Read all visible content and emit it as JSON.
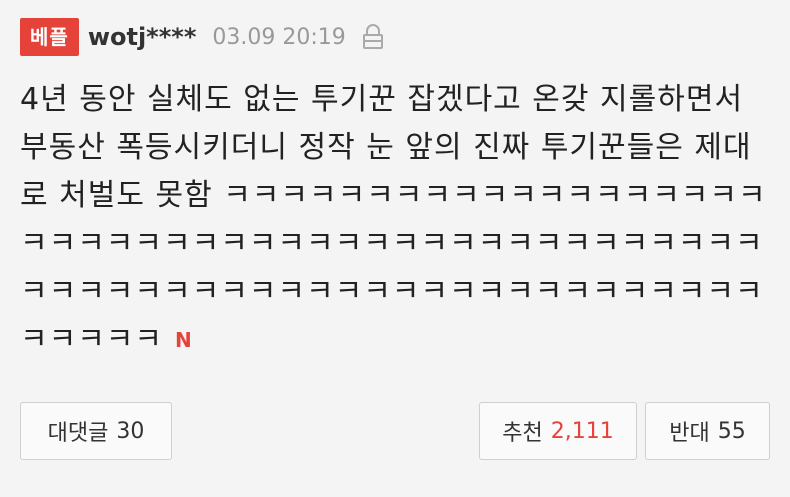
{
  "comment": {
    "badge": "베플",
    "username": "wotj****",
    "timestamp": "03.09 20:19",
    "lock_icon": "lock-icon",
    "text": "4년 동안 실체도 없는 투기꾼 잡겠다고 온갖 지롤하면서 부동산 폭등시키더니 정작 눈 앞의 진짜 투기꾼들은 제대로 처벌도 못함 ㅋㅋㅋㅋㅋㅋㅋㅋㅋㅋㅋㅋㅋㅋㅋㅋㅋㅋㅋㅋㅋㅋㅋㅋㅋㅋㅋㅋㅋㅋㅋㅋㅋㅋㅋㅋㅋㅋㅋㅋㅋㅋㅋㅋㅋㅋㅋㅋㅋㅋㅋㅋㅋㅋㅋㅋㅋㅋㅋㅋㅋㅋㅋㅋㅋㅋㅋㅋㅋㅋㅋㅋㅋㅋㅋㅋ",
    "new_badge": "N"
  },
  "actions": {
    "replies_label": "대댓글",
    "replies_count": "30",
    "recommend_label": "추천",
    "recommend_count": "2,111",
    "oppose_label": "반대",
    "oppose_count": "55"
  },
  "colors": {
    "accent": "#e5433a",
    "muted": "#999999",
    "background": "#f4f4f4"
  }
}
